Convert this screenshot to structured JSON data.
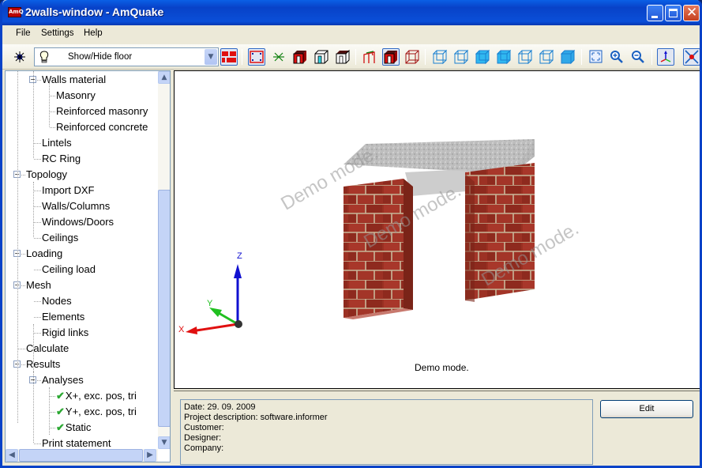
{
  "window": {
    "title": "2walls-window - AmQuake",
    "app_icon": "amquake-logo-icon",
    "controls": [
      "minimize-icon",
      "maximize-icon",
      "close-icon"
    ]
  },
  "menu": [
    {
      "label": "File"
    },
    {
      "label": "Settings"
    },
    {
      "label": "Help"
    }
  ],
  "toolbar": {
    "combo": {
      "icon": "lightbulb-icon",
      "value": "Show/Hide floor"
    },
    "buttons": [
      {
        "icon": "light-icon",
        "pressed": false
      },
      {
        "icon": "brick-wall-icon",
        "pressed": true
      },
      {
        "icon": "node-frame-icon",
        "pressed": true
      },
      {
        "icon": "axis-star-icon",
        "pressed": false
      },
      {
        "icon": "solid-window-wall-icon",
        "pressed": false
      },
      {
        "icon": "outline-window-wall-cyan-icon",
        "pressed": false
      },
      {
        "icon": "outline-window-wall-dark-icon",
        "pressed": false
      },
      {
        "icon": "frame-load-icon",
        "pressed": false
      },
      {
        "icon": "solid-render-icon",
        "pressed": true
      },
      {
        "icon": "wireframe-render-icon",
        "pressed": false
      },
      {
        "icon": "view-cube-1-icon",
        "pressed": false
      },
      {
        "icon": "view-cube-2-icon",
        "pressed": false
      },
      {
        "icon": "view-cube-3-icon",
        "pressed": false
      },
      {
        "icon": "view-cube-4-icon",
        "pressed": false
      },
      {
        "icon": "view-cube-5-icon",
        "pressed": false
      },
      {
        "icon": "view-cube-6-icon",
        "pressed": false
      },
      {
        "icon": "view-iso-icon",
        "pressed": false
      },
      {
        "icon": "zoom-extents-icon",
        "pressed": false
      },
      {
        "icon": "zoom-in-icon",
        "pressed": false
      },
      {
        "icon": "zoom-out-icon",
        "pressed": false
      },
      {
        "icon": "axes-icon",
        "pressed": true
      },
      {
        "icon": "cross-point-icon",
        "pressed": true
      }
    ]
  },
  "tree": {
    "items": [
      {
        "label": "Walls material",
        "level": 1,
        "expander": "minus"
      },
      {
        "label": "Masonry",
        "level": 2
      },
      {
        "label": "Reinforced masonry",
        "level": 2
      },
      {
        "label": "Reinforced concrete",
        "level": 2
      },
      {
        "label": "Lintels",
        "level": 1
      },
      {
        "label": "RC Ring",
        "level": 1
      },
      {
        "label": "Topology",
        "level": 0,
        "expander": "minus"
      },
      {
        "label": "Import DXF",
        "level": 1
      },
      {
        "label": "Walls/Columns",
        "level": 1
      },
      {
        "label": "Windows/Doors",
        "level": 1
      },
      {
        "label": "Ceilings",
        "level": 1
      },
      {
        "label": "Loading",
        "level": 0,
        "expander": "minus"
      },
      {
        "label": "Ceiling load",
        "level": 1
      },
      {
        "label": "Mesh",
        "level": 0,
        "expander": "minus"
      },
      {
        "label": "Nodes",
        "level": 1
      },
      {
        "label": "Elements",
        "level": 1
      },
      {
        "label": "Rigid links",
        "level": 1
      },
      {
        "label": "Calculate",
        "level": 0
      },
      {
        "label": "Results",
        "level": 0,
        "expander": "minus"
      },
      {
        "label": "Analyses",
        "level": 1,
        "expander": "minus"
      },
      {
        "label": "X+, exc. pos, tri",
        "level": 2,
        "checked": true
      },
      {
        "label": "Y+, exc. pos, tri",
        "level": 2,
        "checked": true
      },
      {
        "label": "Static",
        "level": 2,
        "checked": true
      },
      {
        "label": "Print statement",
        "level": 1
      }
    ]
  },
  "viewport": {
    "watermarks": [
      "Demo mode.",
      "Demo mode.",
      "Demo mode."
    ],
    "caption": "Demo mode.",
    "axes": {
      "x": "X",
      "y": "Y",
      "z": "Z"
    },
    "colors": {
      "x": "#e01010",
      "y": "#20c020",
      "z": "#1010d0"
    }
  },
  "info": {
    "lines": [
      "Date: 29. 09. 2009",
      "Project description: software.informer",
      "Customer:",
      "Designer:",
      "Company:"
    ],
    "edit_label": "Edit"
  }
}
